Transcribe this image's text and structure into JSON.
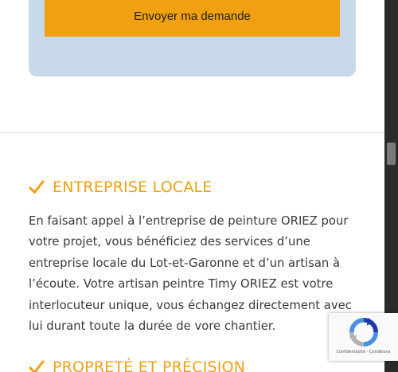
{
  "form": {
    "submit_label": "Envoyer ma demande"
  },
  "sections": [
    {
      "icon": "check-icon",
      "title": "ENTREPRISE LOCALE",
      "body": "En faisant appel à l’entreprise de peinture ORIEZ pour votre projet, vous bénéficiez des services d’une entreprise locale du Lot-et-Garonne et d’un artisan à l’écoute. Votre artisan peintre Timy ORIEZ est votre interlocuteur unique, vous échangez directement avec lui durant toute la durée de vore chantier."
    },
    {
      "icon": "check-icon",
      "title": "PROPRETÉ ET PRÉCISION"
    }
  ],
  "recaptcha": {
    "footer": "Confidentialité - Conditions"
  },
  "colors": {
    "accent": "#f0a011",
    "form_panel": "#c8d9ea",
    "text": "#3a3a3a"
  }
}
